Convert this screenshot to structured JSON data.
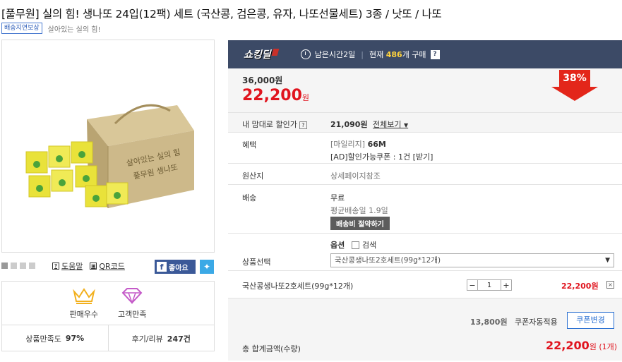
{
  "title": "[풀무원] 실의 힘! 생나또 24입(12팩) 세트 (국산콩, 검은콩, 유자, 나또선물세트) 3종 / 낫또 / 나또",
  "badge": "배송지연보상",
  "slogan": "살아있는 실의 힘!",
  "product_image": {
    "label_left": "실의 힘",
    "label_right": "생나또",
    "box_text_1": "살아있는 실의 힘",
    "box_text_2": "풀무원 생나또",
    "colors": {
      "kraft": "#cdb98a",
      "kraft_dark": "#a48e5c",
      "pack_yellow": "#e9e23a",
      "pack_green": "#49a33b"
    }
  },
  "links": {
    "help": "도움말",
    "qr": "QR코드",
    "like": "좋아요"
  },
  "awards": {
    "best_seller": "판매우수",
    "satisfaction": "고객만족",
    "rating_label": "상품만족도",
    "rating_value": "97%",
    "review_label": "후기/리뷰",
    "review_value": "247건"
  },
  "deal_header": {
    "logo": "쇼킹딜",
    "time_left": "남은시간2일",
    "current_label": "현재",
    "count": "486",
    "count_unit": "개 구매",
    "help": "?"
  },
  "price": {
    "original": "36,000원",
    "sale": "22,200",
    "won": "원",
    "discount": "38%"
  },
  "my_discount": {
    "label": "내 맘대로 할인가",
    "value": "21,090원",
    "link": "전체보기"
  },
  "benefit": {
    "label": "혜택",
    "mileage_prefix": "[마일리지]",
    "mileage": "66M",
    "coupon": "[AD]할인가능쿠폰 : 1건 [받기]"
  },
  "origin": {
    "label": "원산지",
    "value": "상세페이지참조"
  },
  "shipping": {
    "label": "배송",
    "fee": "무료",
    "avg": "평균배송일 1.9일",
    "save_button": "배송비 절약하기"
  },
  "option": {
    "label": "상품선택",
    "heading": "옵션",
    "search": "검색",
    "selected": "국산콩생나또2호세트(99g*12개)"
  },
  "selected_item": {
    "name": "국산콩생나또2호세트(99g*12개)",
    "qty": "1",
    "minus": "−",
    "plus": "+",
    "price": "22,200원",
    "remove": "×"
  },
  "total": {
    "coupon_amount": "13,800원",
    "coupon_applied": "쿠폰자동적용",
    "coupon_change": "쿠폰변경",
    "label": "총 합계금액(수량)",
    "amount": "22,200",
    "won": "원",
    "count": "(1개)"
  }
}
